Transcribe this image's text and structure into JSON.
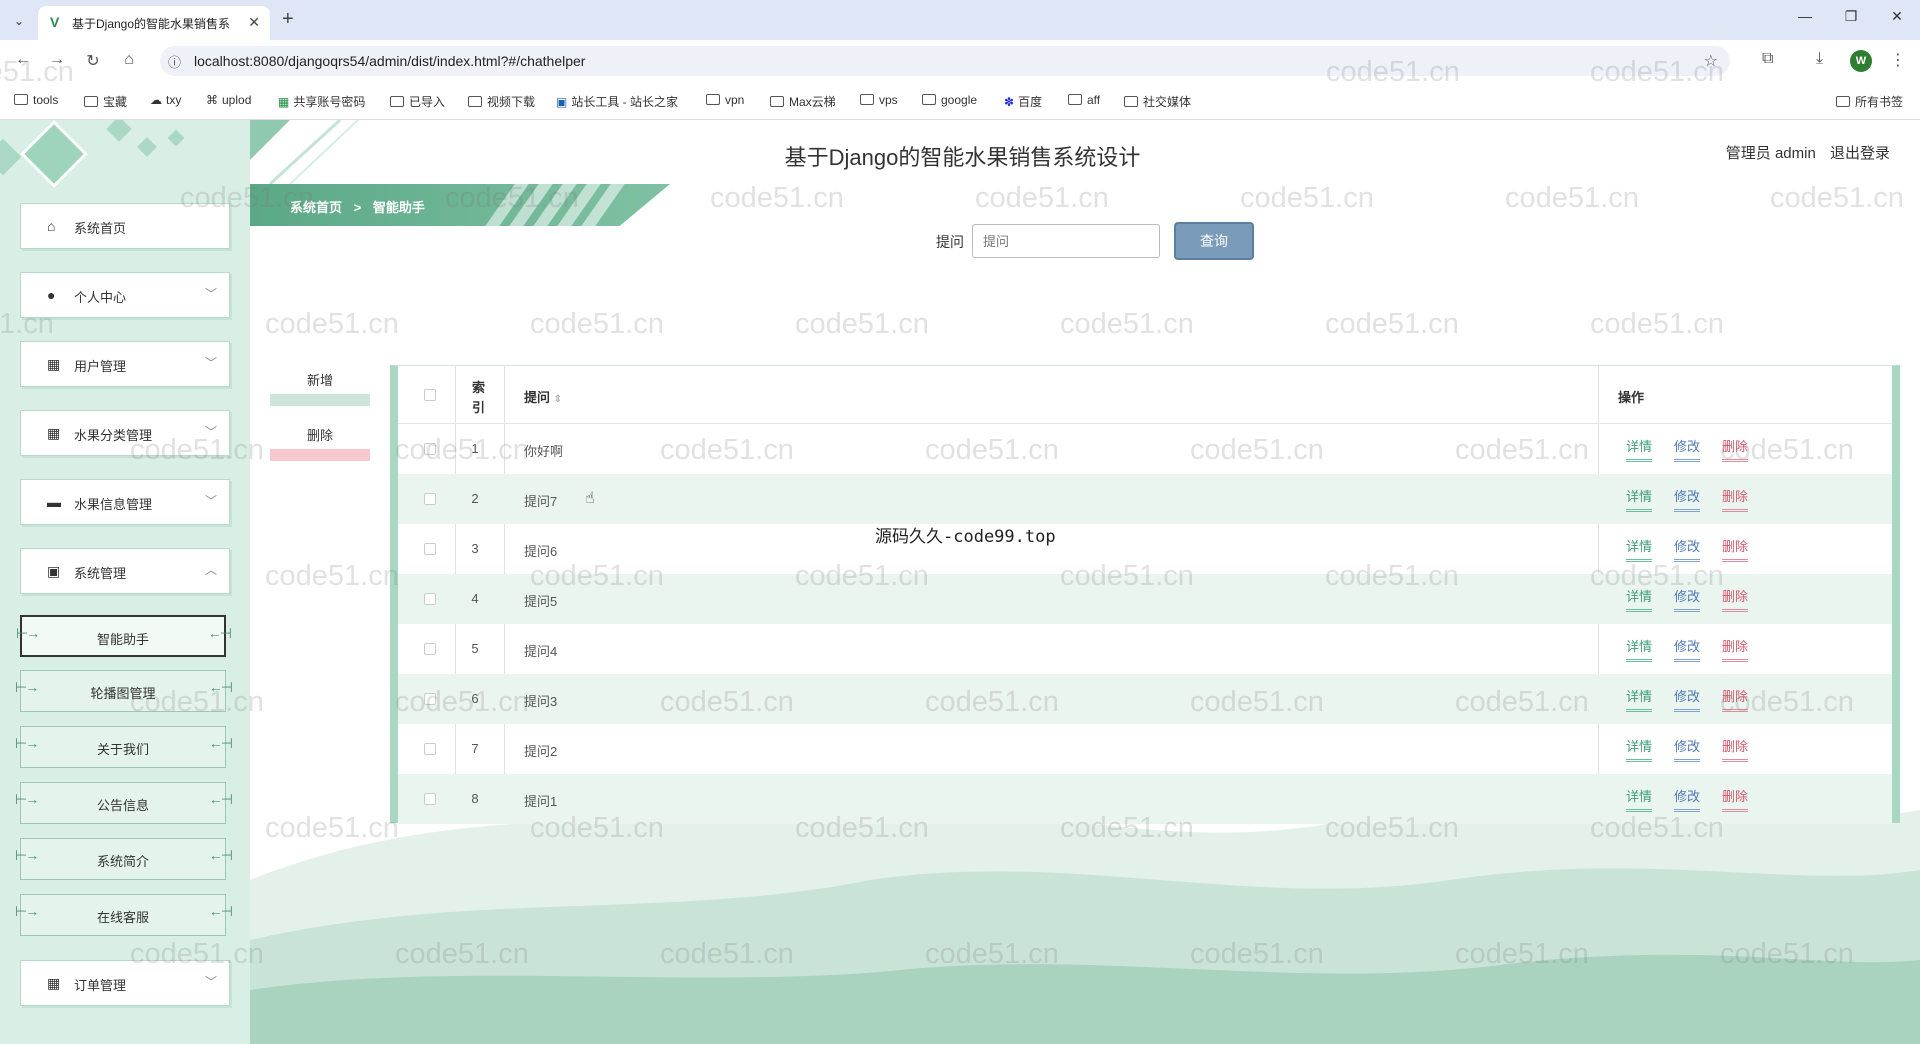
{
  "browser": {
    "tab_title": "基于Django的智能水果销售系",
    "url": "localhost:8080/djangoqrs54/admin/dist/index.html?#/chathelper",
    "avatar_letter": "W",
    "bookmarks": [
      {
        "label": "tools",
        "icon": "folder-icon"
      },
      {
        "label": "宝藏",
        "icon": "folder-icon"
      },
      {
        "label": "txy",
        "icon": "cloud-icon"
      },
      {
        "label": "uplod",
        "icon": "share-icon"
      },
      {
        "label": "共享账号密码",
        "icon": "sheet-icon"
      },
      {
        "label": "已导入",
        "icon": "folder-icon"
      },
      {
        "label": "视频下载",
        "icon": "folder-icon"
      },
      {
        "label": "站长工具 - 站长之家",
        "icon": "tool-icon"
      },
      {
        "label": "vpn",
        "icon": "folder-icon"
      },
      {
        "label": "Max云梯",
        "icon": "folder-icon"
      },
      {
        "label": "vps",
        "icon": "folder-icon"
      },
      {
        "label": "google",
        "icon": "folder-icon"
      },
      {
        "label": "百度",
        "icon": "paw-icon"
      },
      {
        "label": "aff",
        "icon": "folder-icon"
      },
      {
        "label": "社交媒体",
        "icon": "folder-icon"
      }
    ],
    "all_bookmarks": "所有书签"
  },
  "header": {
    "title": "基于Django的智能水果销售系统设计",
    "user": "管理员 admin",
    "logout": "退出登录"
  },
  "breadcrumb": {
    "home": "系统首页",
    "sep": ">",
    "current": "智能助手"
  },
  "sidebar": {
    "menus": [
      {
        "label": "系统首页",
        "icon": "home-icon",
        "chevron": ""
      },
      {
        "label": "个人中心",
        "icon": "user-icon",
        "chevron": "﹀"
      },
      {
        "label": "用户管理",
        "icon": "grid-icon",
        "chevron": "﹀"
      },
      {
        "label": "水果分类管理",
        "icon": "grid-icon",
        "chevron": "﹀"
      },
      {
        "label": "水果信息管理",
        "icon": "monitor-icon",
        "chevron": "﹀"
      },
      {
        "label": "系统管理",
        "icon": "clipboard-icon",
        "chevron": "︿"
      }
    ],
    "sub_items": [
      "智能助手",
      "轮播图管理",
      "关于我们",
      "公告信息",
      "系统简介",
      "在线客服"
    ],
    "order_menu": {
      "label": "订单管理",
      "icon": "grid-icon",
      "chevron": "﹀"
    }
  },
  "search": {
    "label": "提问",
    "placeholder": "提问",
    "button": "查询"
  },
  "actions": {
    "add": "新增",
    "delete": "删除"
  },
  "table": {
    "headers": {
      "index": "索引",
      "question": "提问",
      "ops": "操作"
    },
    "rows": [
      {
        "index": "1",
        "question": "你好啊"
      },
      {
        "index": "2",
        "question": "提问7"
      },
      {
        "index": "3",
        "question": "提问6"
      },
      {
        "index": "4",
        "question": "提问5"
      },
      {
        "index": "5",
        "question": "提问4"
      },
      {
        "index": "6",
        "question": "提问3"
      },
      {
        "index": "7",
        "question": "提问2"
      },
      {
        "index": "8",
        "question": "提问1"
      }
    ],
    "ops": {
      "detail": "详情",
      "edit": "修改",
      "delete": "删除"
    }
  },
  "overlay": "源码久久-code99.top",
  "watermark": "code51.cn",
  "colors": {
    "accent": "#5ba886",
    "sidebar_bg": "#d9efe6",
    "row_alt": "#eaf5ef",
    "delete": "#d45a6e",
    "edit": "#4d79b6",
    "detail": "#3e9c77"
  }
}
